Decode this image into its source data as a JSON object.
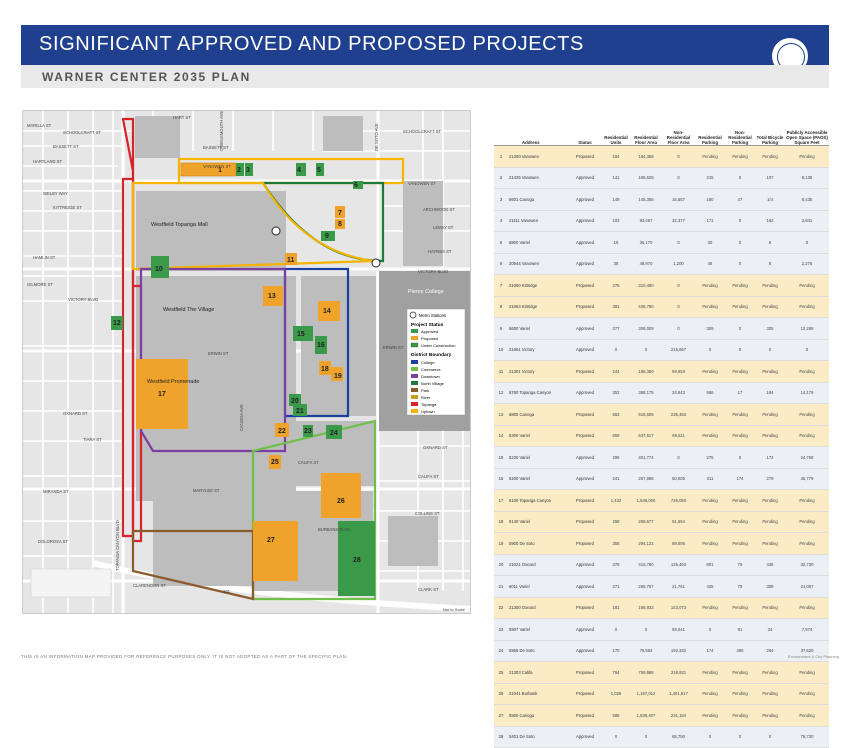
{
  "header": {
    "title": "SIGNIFICANT APPROVED AND PROPOSED PROJECTS",
    "subtitle": "WARNER CENTER 2035 PLAN",
    "seal_text": "CITY OF LOS ANGELES"
  },
  "map": {
    "streets": {
      "marilla": "MARILLA ST",
      "schoolcraft_w": "SCHOOLCRAFT ST",
      "bassett_w": "BASSETT ST",
      "hartland": "HARTLAND ST",
      "welby": "WELBY WAY",
      "kittridge_w": "KITTRIDGE ST",
      "hamlin": "HAMLIN ST",
      "gilmore": "GILMORE ST",
      "vanowen_w": "VANOWEN ST",
      "victory_w": "VICTORY BLVD",
      "erwin": "ERWIN ST",
      "oxnard": "OXNARD ST",
      "tiara": "TIARA ST",
      "califa": "CALIFA ST",
      "marylee": "MARYLEE ST",
      "miranda": "MIRANDA ST",
      "dolorosa": "DOLOROSA ST",
      "clarendon": "CLARENDON ST",
      "hart": "HART ST",
      "schoolcraft_e": "SCHOOLCRAFT ST",
      "bassett_e": "BASSETT ST",
      "vanowen_e": "VANOWEN ST",
      "archwood": "ARCHWOOD ST",
      "lemay": "LEMAY ST",
      "haynes": "HAYNES ST",
      "victory_e": "VICTORY BLVD",
      "erwin_e": "ERWIN ST",
      "oxnard_e": "OXNARD ST",
      "califa_e": "CALIFA ST",
      "burbank": "BURBANK BLVD",
      "collins": "COLLINS ST",
      "clark": "CLARK ST",
      "topanga": "TOPANGA CANYON BLVD",
      "owensmouth": "OWENSMOUTH AVE",
      "canoga": "CANOGA AVE",
      "de_soto": "DE SOTO AVE",
      "fwy": "101"
    },
    "places": {
      "topanga_mall": "Westfield Topanga Mall",
      "the_village": "Westfield The Village",
      "promenade": "Westfield Promenade",
      "pierce": "Pierce College"
    },
    "legend": {
      "metro_stations": "Metro Stations",
      "status_title": "Project Status",
      "approved": "Approved",
      "proposed": "Proposed",
      "under_construction": "Under Construction",
      "district_title": "District Boundary",
      "districts": [
        "College",
        "Commerce",
        "Downtown",
        "North Village",
        "Park",
        "River",
        "Topanga",
        "Uptown"
      ]
    },
    "project_labels": [
      "1",
      "2",
      "3",
      "4",
      "5",
      "6",
      "7",
      "8",
      "9",
      "10",
      "11",
      "12",
      "13",
      "14",
      "15",
      "16",
      "17",
      "18",
      "19",
      "20",
      "21",
      "22",
      "23",
      "24",
      "25",
      "26",
      "27",
      "28"
    ],
    "scale_note": "Not to Scale",
    "colors": {
      "approved": "#3a9a4a",
      "proposed": "#f0a32a",
      "under_construction": "#3a9a4a",
      "college": "#1a3fa0",
      "commerce": "#6fbf4a",
      "downtown": "#7a3fa0",
      "north_village": "#1f7a3a",
      "park": "#8b5a2b",
      "river": "#c8a020",
      "topanga": "#d8232a",
      "uptown": "#f5b400"
    }
  },
  "table": {
    "headers": [
      "",
      "Address",
      "Status",
      "Residential Units",
      "Residential Floor Area",
      "Non-Residential Floor Area",
      "Residential Parking",
      "Non-Residential Parking",
      "Total Bicycle Parking",
      "Publicly Accessible Open Space (PAOS) Square Feet"
    ],
    "rows": [
      [
        "1",
        "21300 Vanowen",
        "Proposed",
        "184",
        "184,358",
        "0",
        "Pending",
        "Pending",
        "Pending",
        "Pending"
      ],
      [
        "2",
        "21425 Vanowen",
        "Approved",
        "141",
        "165,528",
        "0",
        "215",
        "0",
        "197",
        "8,135"
      ],
      [
        "3",
        "6601 Canoga",
        "Approved",
        "149",
        "145,356",
        "16,557",
        "160",
        "47",
        "1/4",
        "8,435"
      ],
      [
        "4",
        "21111 Vanowen",
        "Approved",
        "103",
        "93,467",
        "32,377",
        "171",
        "0",
        "162",
        "3,841"
      ],
      [
        "5",
        "6800 Variel",
        "Approved",
        "19",
        "35,170",
        "0",
        "30",
        "0",
        "8",
        "0"
      ],
      [
        "6",
        "20944 Vanowen",
        "Approved",
        "38",
        "48,970",
        "1,200",
        "46",
        "0",
        "8",
        "2,276"
      ],
      [
        "7",
        "21050 Kittridge",
        "Proposed",
        "275",
        "310,490",
        "0",
        "Pending",
        "Pending",
        "Pending",
        "Pending"
      ],
      [
        "8",
        "21053 Kittridge",
        "Proposed",
        "381",
        "438,790",
        "0",
        "Pending",
        "Pending",
        "Pending",
        "Pending"
      ],
      [
        "9",
        "6600 Variel",
        "Approved",
        "277",
        "306,009",
        "0",
        "309",
        "0",
        "305",
        "12,288"
      ],
      [
        "10",
        "21651 Victory",
        "Approved",
        "0",
        "0",
        "215,667",
        "0",
        "0",
        "0",
        "0"
      ],
      [
        "11",
        "21301 Victory",
        "Proposed",
        "244",
        "195,350",
        "59,653",
        "Pending",
        "Pending",
        "Pending",
        "Pending"
      ],
      [
        "12",
        "6760 Topanga Canyon",
        "Approved",
        "352",
        "388,175",
        "24,843",
        "586",
        "17",
        "194",
        "14,176"
      ],
      [
        "13",
        "6800 Canoga",
        "Proposed",
        "653",
        "616,605",
        "235,463",
        "Pending",
        "Pending",
        "Pending",
        "Pending"
      ],
      [
        "14",
        "6300 Variel",
        "Proposed",
        "659",
        "637,517",
        "69,511",
        "Pending",
        "Pending",
        "Pending",
        "Pending"
      ],
      [
        "15",
        "6220 Variel",
        "Approved",
        "295",
        "401,774",
        "0",
        "275",
        "0",
        "172",
        "24,768"
      ],
      [
        "16",
        "6200 Variel",
        "Approved",
        "241",
        "257,896",
        "50,005",
        "311",
        "174",
        "279",
        "45,779"
      ],
      [
        "17",
        "6100 Topanga Canyon",
        "Proposed",
        "1,432",
        "1,548,000",
        "726,050",
        "Pending",
        "Pending",
        "Pending",
        "Pending"
      ],
      [
        "18",
        "6140 Variel",
        "Proposed",
        "268",
        "269,677",
        "51,664",
        "Pending",
        "Pending",
        "Pending",
        "Pending"
      ],
      [
        "19",
        "5900 De Soto",
        "Proposed",
        "358",
        "294,122",
        "89,095",
        "Pending",
        "Pending",
        "Pending",
        "Pending"
      ],
      [
        "20",
        "21021 Oxnard",
        "Approved",
        "379",
        "415,780",
        "125,463",
        "601",
        "79",
        "438",
        "32,730"
      ],
      [
        "21",
        "6011 Variel",
        "Approved",
        "271",
        "266,757",
        "21,761",
        "425",
        "79",
        "308",
        "21,057"
      ],
      [
        "22",
        "21300 Oxnard",
        "Proposed",
        "181",
        "166,932",
        "143,073",
        "Pending",
        "Pending",
        "Pending",
        "Pending"
      ],
      [
        "23",
        "5907 Variel",
        "Approved",
        "0",
        "0",
        "93,041",
        "0",
        "91",
        "34",
        "7,974"
      ],
      [
        "24",
        "5955 De Soto",
        "Approved",
        "170",
        "79,564",
        "192,332",
        "174",
        "490",
        "264",
        "37,620"
      ],
      [
        "25",
        "21303 Califa",
        "Proposed",
        "794",
        "759,988",
        "218,931",
        "Pending",
        "Pending",
        "Pending",
        "Pending"
      ],
      [
        "26",
        "21041 Burbank",
        "Proposed",
        "1,029",
        "1,197,012",
        "1,401,817",
        "Pending",
        "Pending",
        "Pending",
        "Pending"
      ],
      [
        "27",
        "5500 Canoga",
        "Proposed",
        "586",
        "1,538,407",
        "231,184",
        "Pending",
        "Pending",
        "Pending",
        "Pending"
      ],
      [
        "28",
        "5401 De Soto",
        "Approved",
        "0",
        "0",
        "65,790",
        "0",
        "0",
        "0",
        "76,730"
      ]
    ]
  },
  "footnote": "THIS IS AN INFORMATION MAP PROVIDED FOR REFERENCE PURPOSES ONLY. IT IS NOT ADOPTED AS A PART OF THE SPECIFIC PLAN.",
  "credit": "Environment & City Planning"
}
